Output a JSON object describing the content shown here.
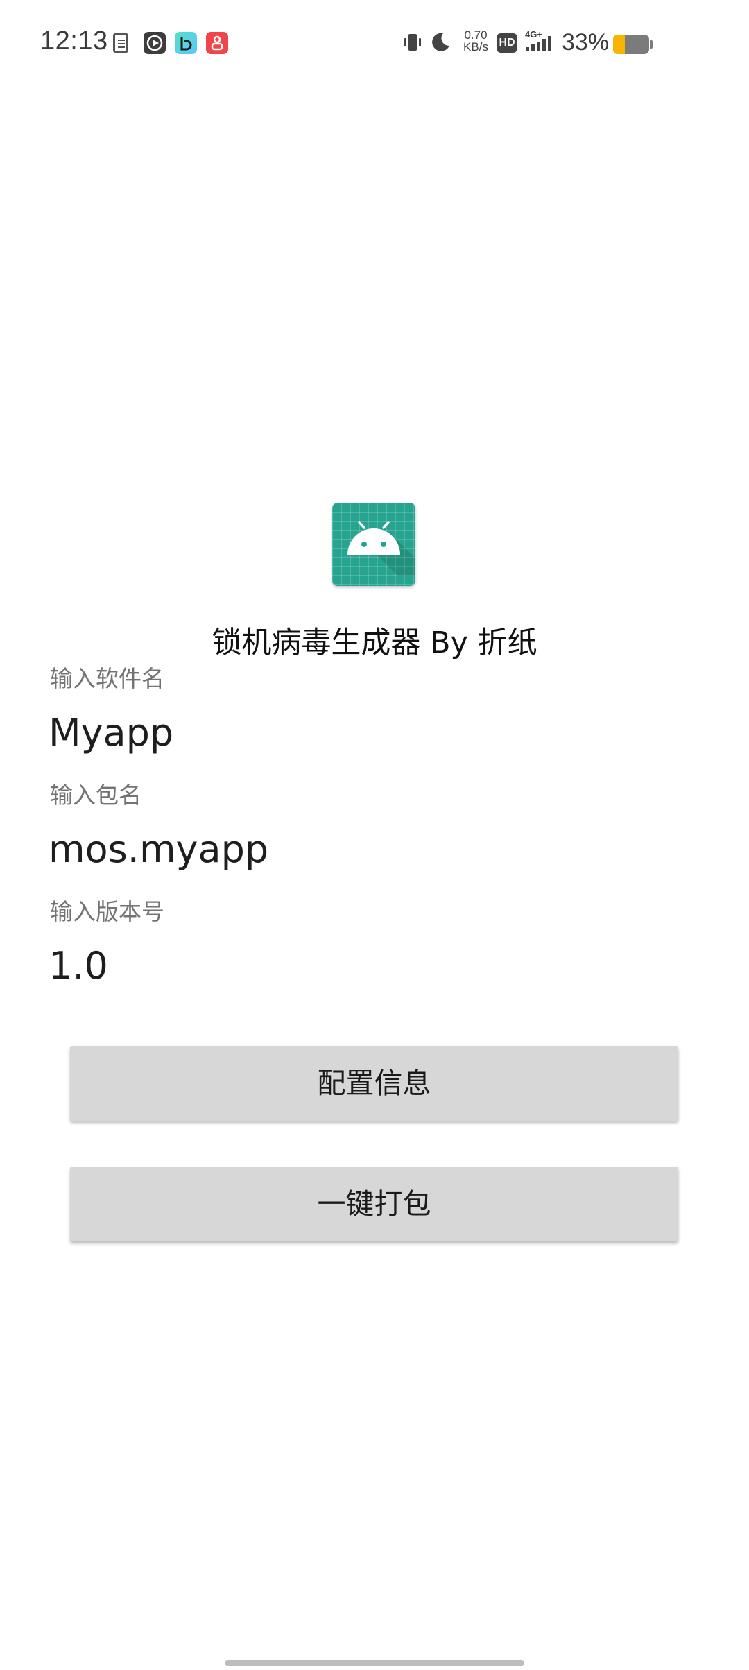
{
  "status_bar": {
    "time": "12:13",
    "network_speed_value": "0.70",
    "network_speed_unit": "KB/s",
    "hd_label": "HD",
    "network_type": "4G+",
    "battery_percent": "33%",
    "battery_level": 0.33,
    "notification_icons": [
      "file-icon",
      "video-play-icon",
      "bilibili-app-icon",
      "red-app-icon"
    ],
    "system_icons": [
      "vibrate-icon",
      "moon-icon",
      "hd-icon",
      "signal-icon",
      "battery-icon"
    ]
  },
  "app": {
    "icon": "android-robot-icon",
    "title": "锁机病毒生成器 By 折纸"
  },
  "form": {
    "fields": [
      {
        "label": "输入软件名",
        "value": "Myapp"
      },
      {
        "label": "输入包名",
        "value": "mos.myapp"
      },
      {
        "label": "输入版本号",
        "value": "1.0"
      }
    ]
  },
  "buttons": {
    "configure": "配置信息",
    "package": "一键打包"
  },
  "colors": {
    "icon_background": "#26a48f",
    "button_background": "#d6d7d6",
    "battery_fill": "#f7b500"
  }
}
